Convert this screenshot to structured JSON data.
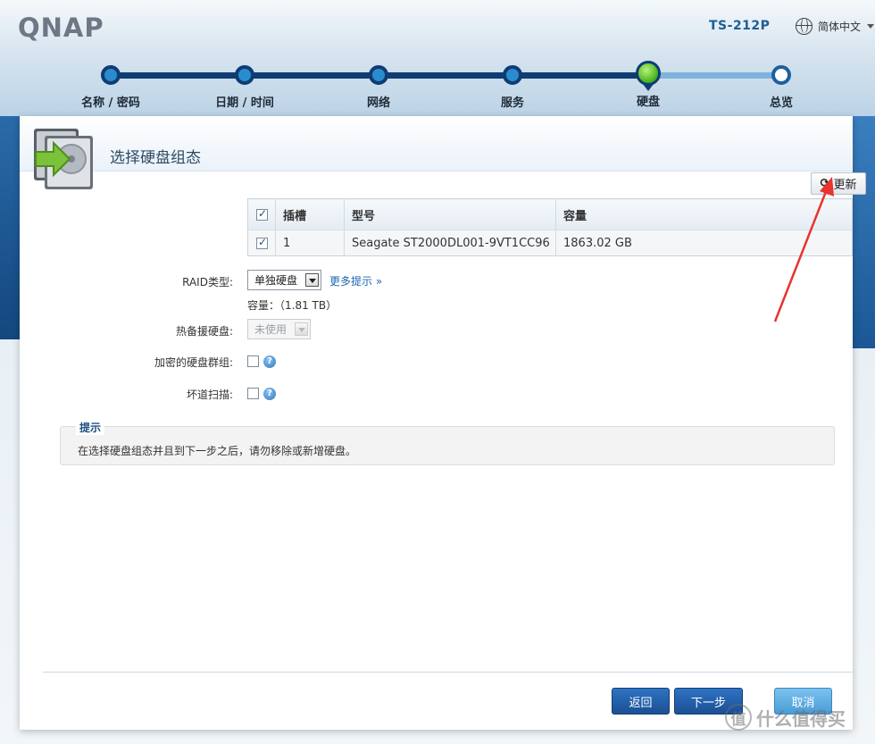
{
  "header": {
    "logo": "QNAP",
    "model": "TS-212P",
    "language": "简体中文"
  },
  "steps": [
    {
      "label": "名称 / 密码",
      "state": "done"
    },
    {
      "label": "日期 / 时间",
      "state": "done"
    },
    {
      "label": "网络",
      "state": "done"
    },
    {
      "label": "服务",
      "state": "done"
    },
    {
      "label": "硬盘",
      "state": "current"
    },
    {
      "label": "总览",
      "state": "todo"
    }
  ],
  "panel": {
    "title": "选择硬盘组态",
    "refresh_label": "更新"
  },
  "table": {
    "columns": [
      "插槽",
      "型号",
      "容量"
    ],
    "rows": [
      {
        "slot": "1",
        "model": "Seagate ST2000DL001-9VT1CC96",
        "capacity": "1863.02 GB",
        "checked": true
      }
    ]
  },
  "form": {
    "raid_label": "RAID类型:",
    "raid_value": "单独硬盘",
    "more_hints": "更多提示 »",
    "capacity_text": "容量：（1.81 TB）",
    "hot_spare_label": "热备援硬盘:",
    "hot_spare_value": "未使用",
    "encrypt_label": "加密的硬盘群组:",
    "bad_block_label": "坏道扫描:"
  },
  "tip": {
    "title": "提示",
    "text": "在选择硬盘组态并且到下一步之后，请勿移除或新增硬盘。"
  },
  "buttons": {
    "back": "返回",
    "next": "下一步",
    "cancel": "取消"
  },
  "watermark": {
    "icon_char": "值",
    "text": "什么值得买"
  }
}
